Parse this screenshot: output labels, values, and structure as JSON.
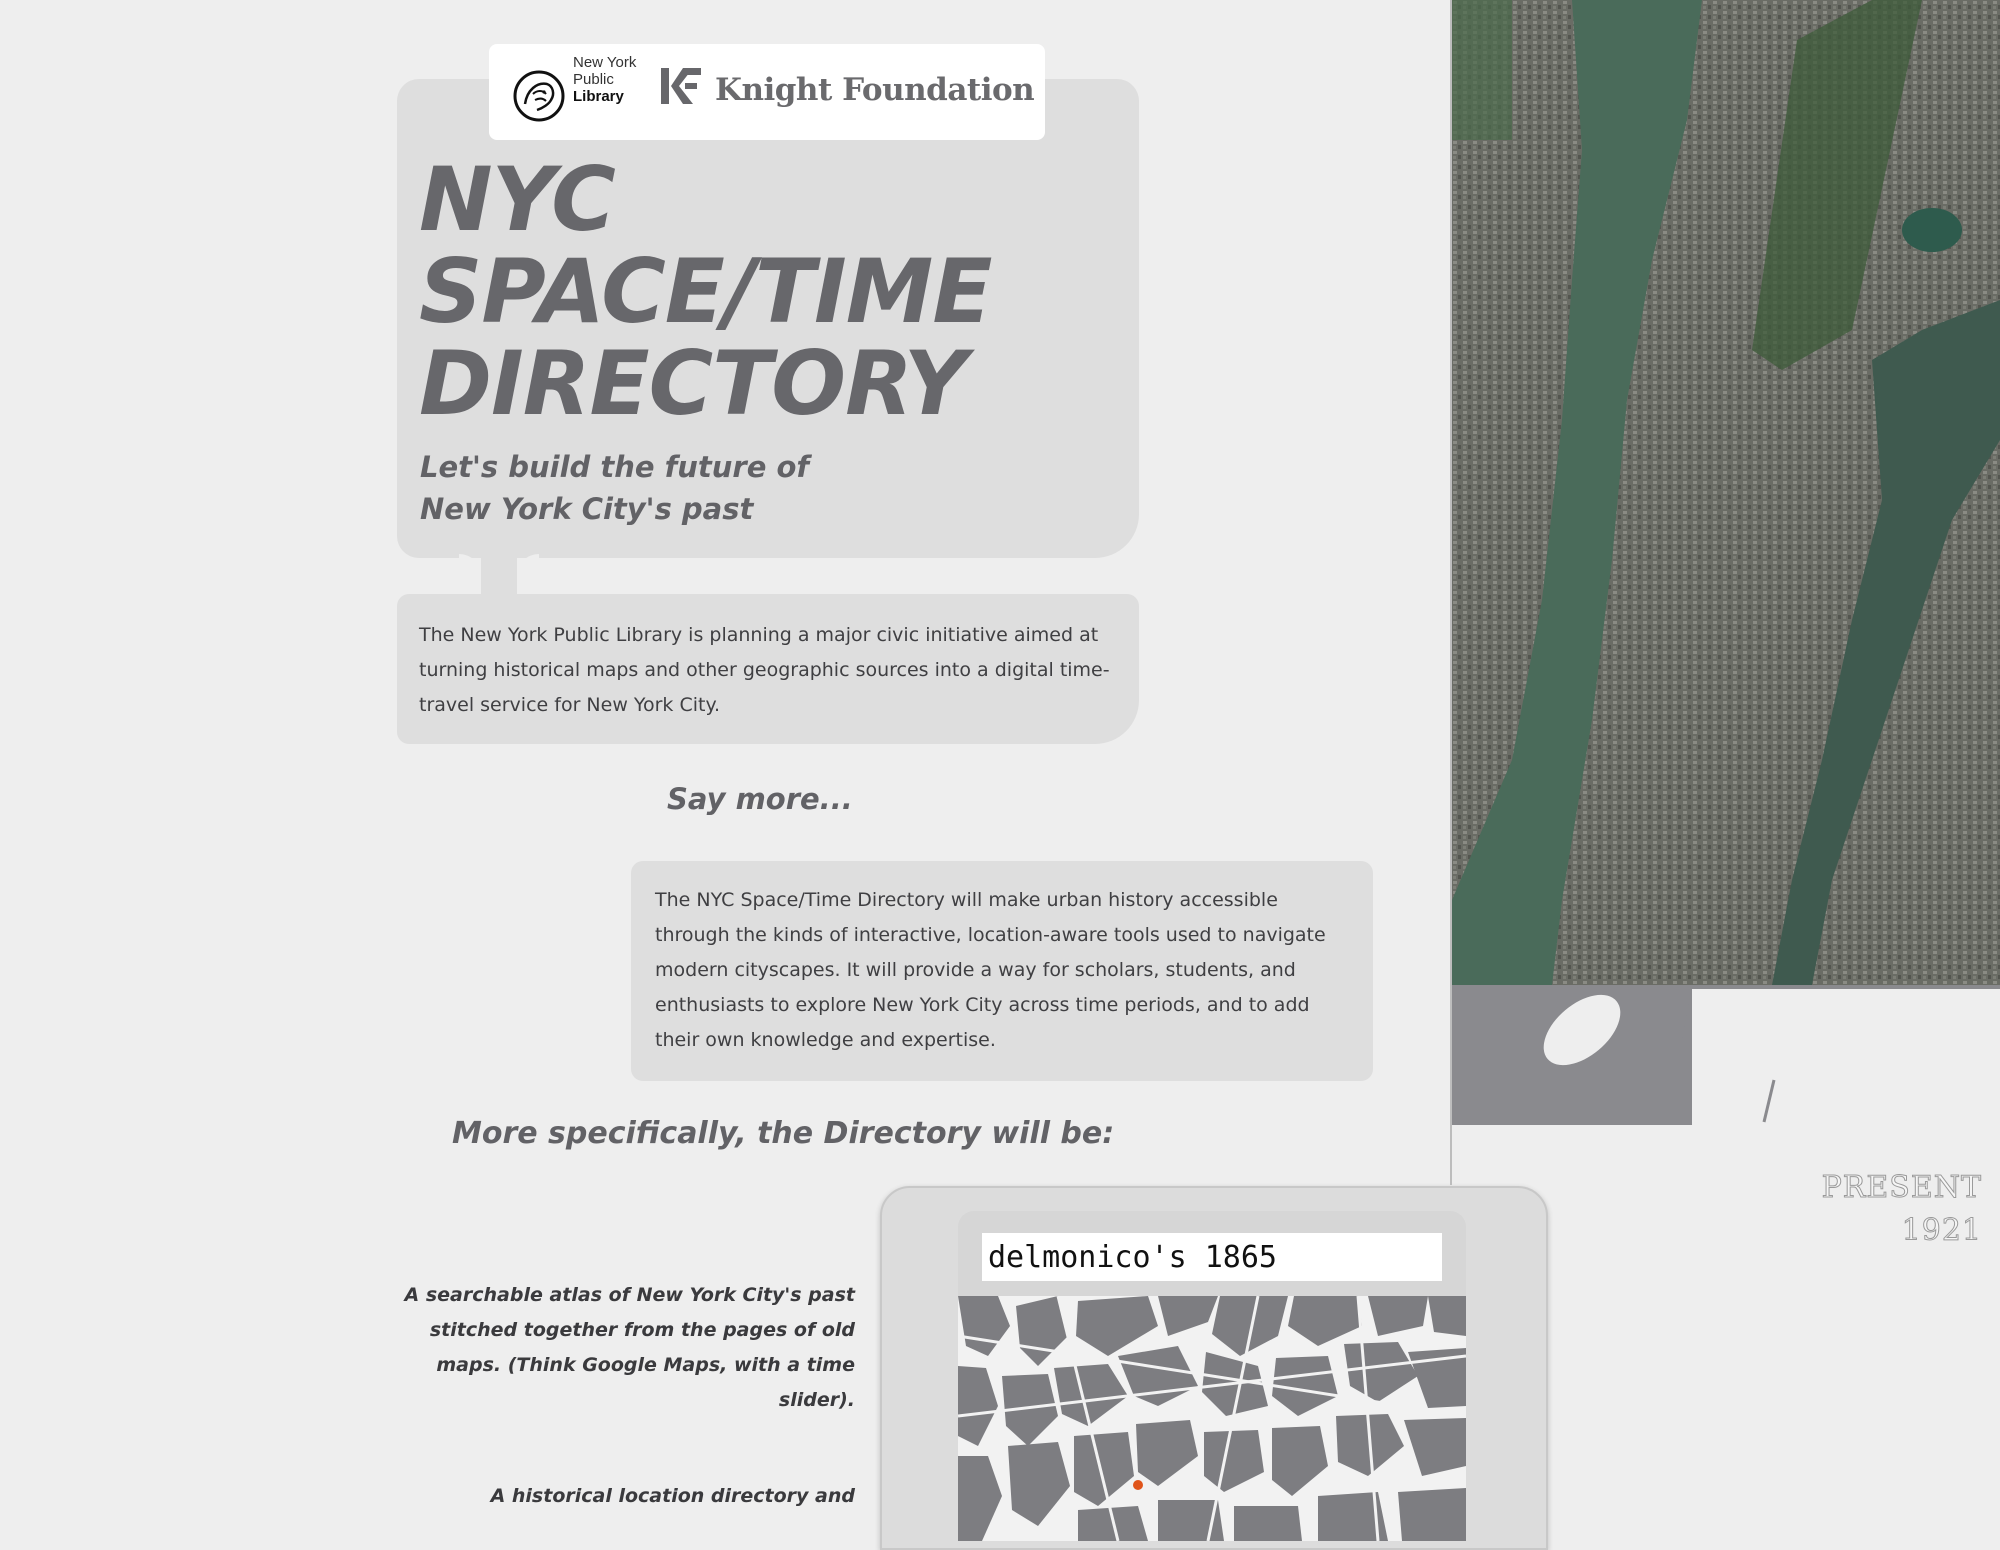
{
  "logos": {
    "nypl": [
      "New York",
      "Public",
      "Library"
    ],
    "knight": "Knight Foundation"
  },
  "hero": {
    "title_lines": [
      "NYC",
      "SPACE/TIME",
      "DIRECTORY"
    ],
    "tagline_lines": [
      "Let's build the future of",
      "New York City's past"
    ]
  },
  "intro": "The New York Public Library is planning a major civic initiative aimed at turning historical maps and other geographic sources into a digital time-travel service for New York City.",
  "say_more": "Say more...",
  "more_text": "The NYC Space/Time Directory will make urban history accessible through the kinds of interactive, location-aware tools used to navigate modern cityscapes. It will provide a way for scholars, students, and enthusiasts to explore New York City across time periods, and to add their own knowledge and expertise.",
  "specifically": "More specifically, the Directory will be:",
  "features": [
    "A searchable atlas of New York City's past stitched together from the pages of old maps. (Think Google Maps, with a time slider).",
    "A historical location directory and"
  ],
  "phone": {
    "search_value": "delmonico's 1865"
  },
  "timeline": {
    "labels": [
      "PRESENT",
      "1921"
    ]
  },
  "colors": {
    "background": "#eeeeee",
    "panel": "#dedede",
    "heading": "#67676b",
    "map_water": "#3b5a4e",
    "map_land": "#6f7168",
    "marker": "#e0541a"
  }
}
